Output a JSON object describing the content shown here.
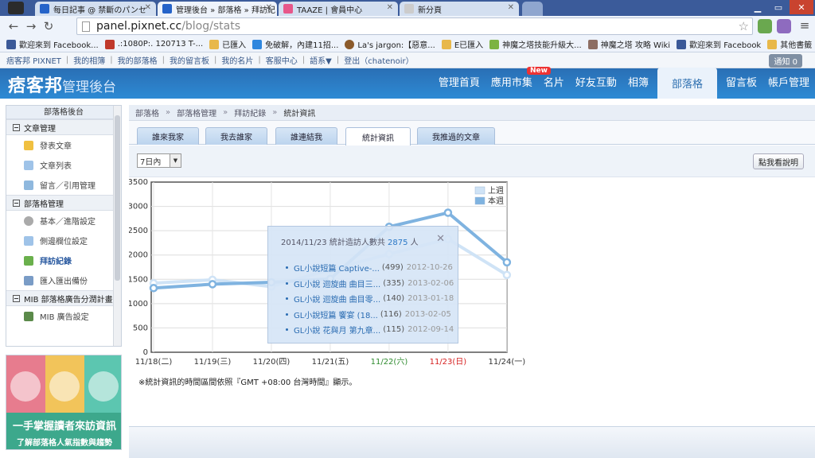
{
  "browser": {
    "tabs": [
      {
        "label": "每日記事 @ 禁斷のパンセ",
        "active": false,
        "color": "#2563c9"
      },
      {
        "label": "管理後台 » 部落格 » 拜訪紀",
        "active": true,
        "color": "#2563c9"
      },
      {
        "label": "TAAZE | 會員中心",
        "active": false,
        "color": "#e7578a"
      },
      {
        "label": "新分頁",
        "active": false,
        "color": "#cccccc"
      }
    ],
    "url_host": "panel.pixnet.cc",
    "url_path": "/blog/stats",
    "bookmarks": [
      {
        "label": "歡迎來到 Facebook...",
        "color": "#3b5998"
      },
      {
        "label": ".:1080P:. 120713 T-...",
        "color": "#c0392b"
      },
      {
        "label": "已匯入",
        "color": "#e8b84a"
      },
      {
        "label": "免破解，內建11招...",
        "color": "#2e86de"
      },
      {
        "label": "La's jargon:【惡意...",
        "color": "#8b5a2b"
      },
      {
        "label": "E已匯入",
        "color": "#e8b84a"
      },
      {
        "label": "神魔之塔技能升級大...",
        "color": "#7cb342"
      },
      {
        "label": "神魔之塔 攻略 Wiki",
        "color": "#8d6e63"
      },
      {
        "label": "歡迎來到 Facebook",
        "color": "#3b5998"
      },
      {
        "label": "其他書籤",
        "color": "#e8b84a"
      }
    ]
  },
  "site_links": [
    "痞客邦 PIXNET",
    "我的相簿",
    "我的部落格",
    "我的留言板",
    "我的名片",
    "客服中心",
    "語系▼",
    "登出（chatenoir）"
  ],
  "notice_label": "通知 0",
  "header": {
    "logo": "痞客邦",
    "title": "管理後台",
    "nav": [
      "管理首頁",
      "應用市集",
      "名片",
      "好友互動",
      "相簿",
      "部落格",
      "留言板",
      "帳戶管理"
    ],
    "new_badge": "New"
  },
  "sidebar": {
    "title": "部落格後台",
    "sections": [
      {
        "title": "文章管理",
        "items": [
          "發表文章",
          "文章列表",
          "留言／引用管理"
        ]
      },
      {
        "title": "部落格管理",
        "items": [
          "基本／進階設定",
          "側邊欄位設定",
          "拜訪紀錄",
          "匯入匯出備份"
        ]
      },
      {
        "title": "MIB 部落格廣告分潤計畫",
        "items": [
          "MIB 廣告設定"
        ]
      }
    ],
    "current_item": "拜訪紀錄"
  },
  "promo": {
    "line1": "一手掌握讀者來訪資訊",
    "line2": "了解部落格人氣指數與趨勢"
  },
  "breadcrumb": [
    "部落格",
    "部落格管理",
    "拜訪紀錄",
    "統計資訊"
  ],
  "page_tabs": [
    "誰來我家",
    "我去誰家",
    "誰連結我",
    "統計資訊",
    "我推過的文章"
  ],
  "active_tab": "統計資訊",
  "range_select": "7日內",
  "help_button": "點我看說明",
  "footnote": "※統計資訊的時間區間依照『GMT +08:00 台灣時間』顯示。",
  "popup": {
    "title_prefix": "2014/11/23 統計造訪人數共",
    "total": "2875",
    "title_suffix": "人",
    "close": "✕",
    "articles": [
      {
        "title": "GL小說短篇 Captive-...",
        "count": "(499)",
        "date": "2012-10-26"
      },
      {
        "title": "GL小說 迴旋曲 曲目三...",
        "count": "(335)",
        "date": "2013-02-06"
      },
      {
        "title": "GL小說 迴旋曲 曲目零...",
        "count": "(140)",
        "date": "2013-01-18"
      },
      {
        "title": "GL小說短篇 饗宴 (18...",
        "count": "(116)",
        "date": "2013-02-05"
      },
      {
        "title": "GL小說 花與月 第九章...",
        "count": "(115)",
        "date": "2012-09-14"
      }
    ]
  },
  "chart_data": {
    "type": "line",
    "categories": [
      "11/18(二)",
      "11/19(三)",
      "11/20(四)",
      "11/21(五)",
      "11/22(六)",
      "11/23(日)",
      "11/24(一)"
    ],
    "category_colors": [
      "#333333",
      "#333333",
      "#333333",
      "#333333",
      "#2e8b2e",
      "#d62020",
      "#333333"
    ],
    "series": [
      {
        "name": "上週",
        "values": [
          1420,
          1490,
          1350,
          1700,
          2020,
          2330,
          1590
        ],
        "color": "#cfe3f6"
      },
      {
        "name": "本週",
        "values": [
          1320,
          1400,
          1440,
          1510,
          2580,
          2870,
          1850
        ],
        "color": "#7fb3e0"
      }
    ],
    "ylim": [
      0,
      3500
    ],
    "yticks": [
      0,
      500,
      1000,
      1500,
      2000,
      2500,
      3000,
      3500
    ],
    "grid": true,
    "legend": "top-right",
    "title": "",
    "xlabel": "",
    "ylabel": ""
  }
}
